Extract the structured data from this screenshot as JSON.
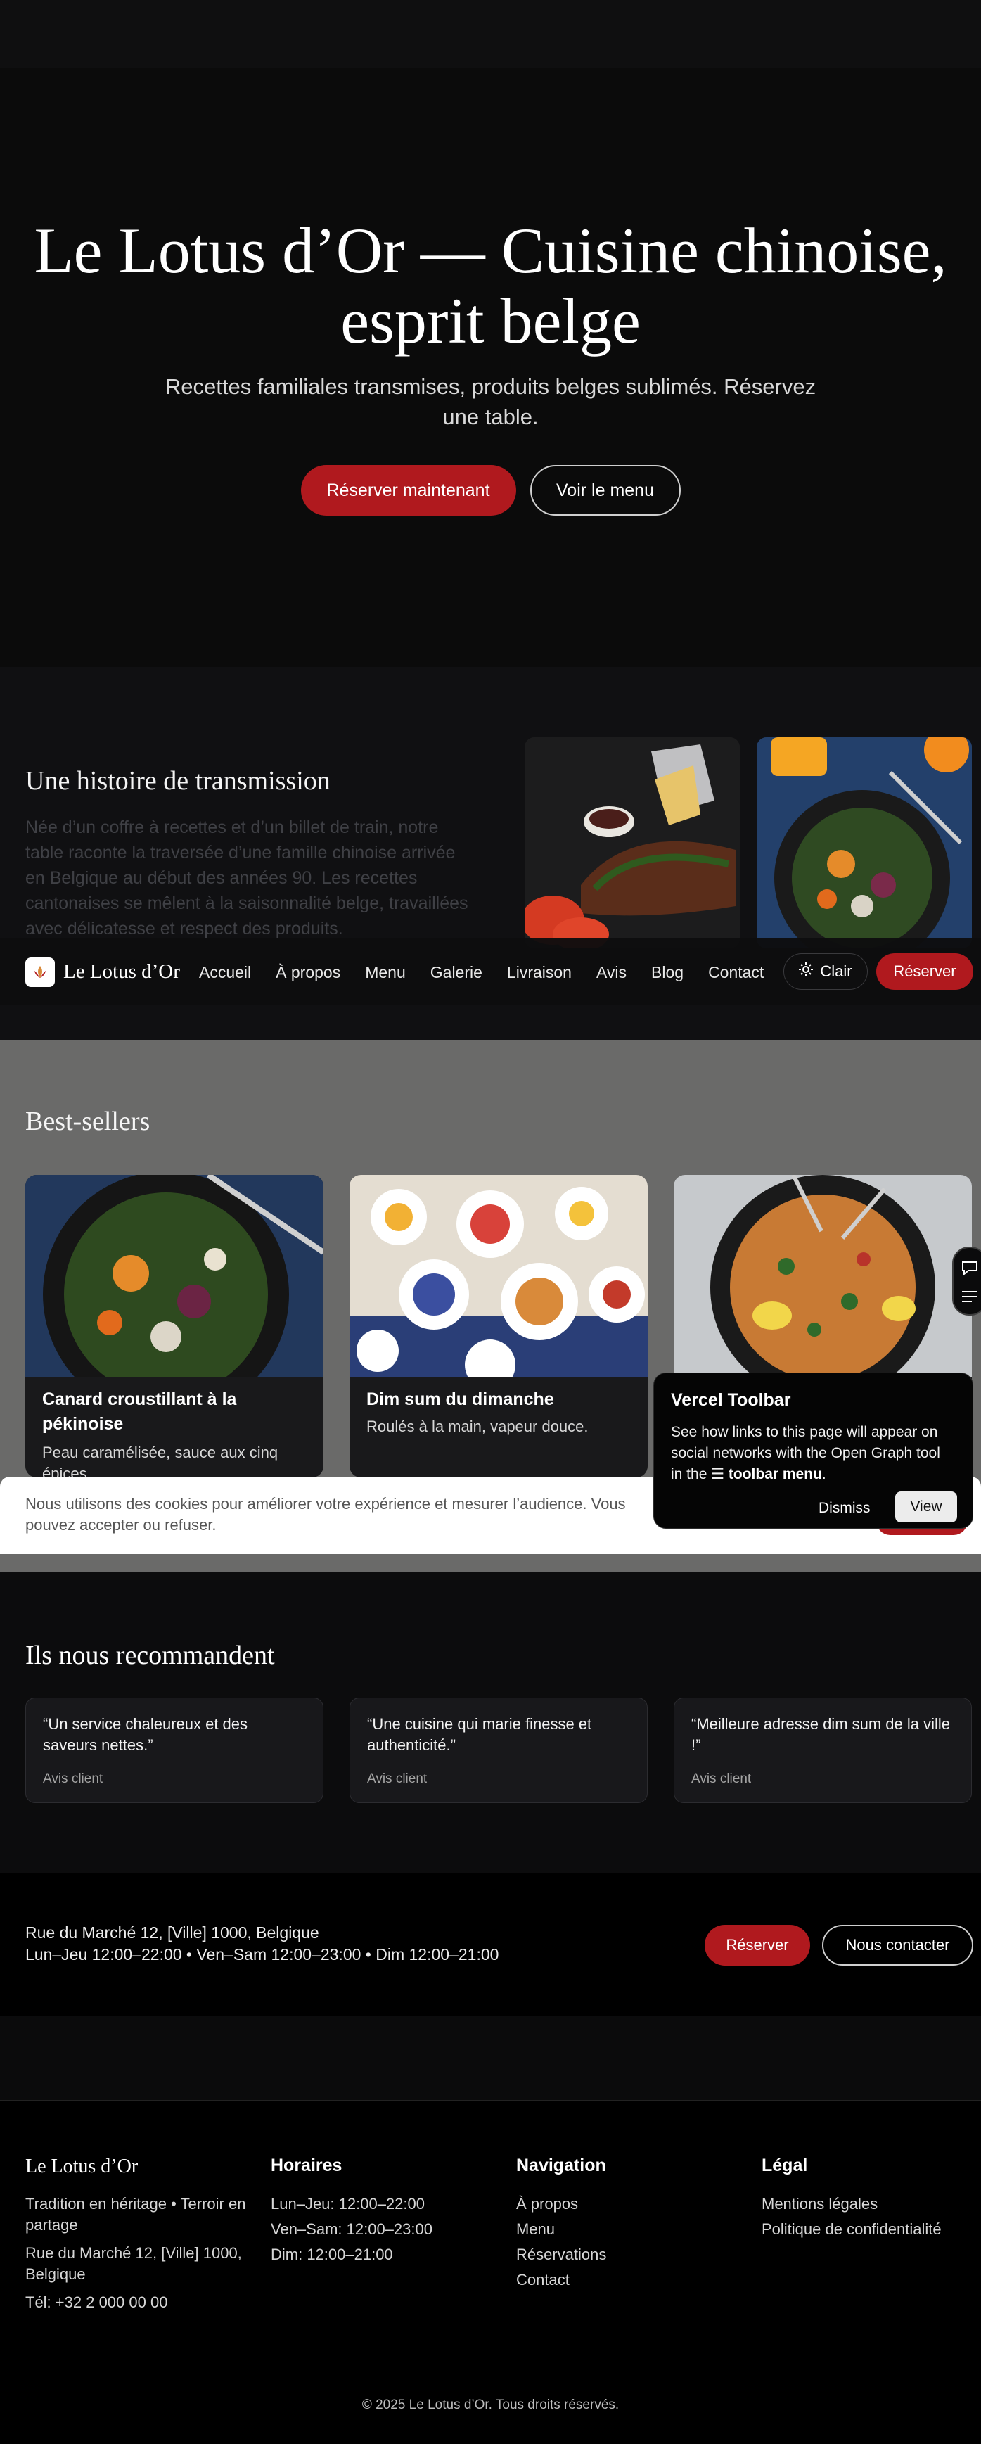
{
  "hero": {
    "title": "Le Lotus d’Or — Cuisine chinoise, esprit belge",
    "subtitle": "Recettes familiales transmises, produits belges sublimés. Réservez une table.",
    "primary_button": "Réserver maintenant",
    "secondary_button": "Voir le menu"
  },
  "story": {
    "title": "Une histoire de transmission",
    "text": "Née d’un coffre à recettes et d’un billet de train, notre table raconte la traversée d’une famille chinoise arrivée en Belgique au début des années 90. Les recettes cantonaises se mêlent à la saisonnalité belge, travaillées avec délicatesse et respect des produits."
  },
  "nav": {
    "brand": "Le Lotus d’Or",
    "links": [
      "Accueil",
      "À propos",
      "Menu",
      "Galerie",
      "Livraison",
      "Avis",
      "Blog",
      "Contact"
    ],
    "theme_label": "Clair",
    "reserve": "Réserver"
  },
  "bestsellers": {
    "title": "Best-sellers",
    "items": [
      {
        "name": "Canard croustillant à la pékinoise",
        "desc": "Peau caramélisée, sauce aux cinq épices."
      },
      {
        "name": "Dim sum du dimanche",
        "desc": "Roulés à la main, vapeur douce."
      },
      {
        "name": "",
        "desc": ""
      }
    ]
  },
  "vercel": {
    "title": "Vercel Toolbar",
    "body_pre": "See how links to this page will appear on social networks with the Open Graph tool in the ",
    "body_bold": "toolbar menu",
    "body_post": ".",
    "dismiss": "Dismiss",
    "view": "View"
  },
  "cookie": {
    "text": "Nous utilisons des cookies pour améliorer votre expérience et mesurer l’audience. Vous pouvez accepter ou refuser."
  },
  "reviews": {
    "title": "Ils nous recommandent",
    "items": [
      {
        "quote": "“Un service chaleureux et des saveurs nettes.”",
        "author": "Avis client"
      },
      {
        "quote": "“Une cuisine qui marie finesse et authenticité.”",
        "author": "Avis client"
      },
      {
        "quote": "“Meilleure adresse dim sum de la ville !”",
        "author": "Avis client"
      }
    ]
  },
  "address": {
    "line1": "Rue du Marché 12, [Ville] 1000, Belgique",
    "line2": "Lun–Jeu 12:00–22:00 • Ven–Sam 12:00–23:00 • Dim 12:00–21:00",
    "reserve": "Réserver",
    "contact": "Nous contacter"
  },
  "footer": {
    "brand": "Le Lotus d’Or",
    "tagline": "Tradition en héritage • Terroir en partage",
    "address": "Rue du Marché 12, [Ville] 1000, Belgique",
    "phone": "Tél: +32 2 000 00 00",
    "hours_title": "Horaires",
    "hours": [
      "Lun–Jeu: 12:00–22:00",
      "Ven–Sam: 12:00–23:00",
      "Dim: 12:00–21:00"
    ],
    "nav_title": "Navigation",
    "nav": [
      "À propos",
      "Menu",
      "Réservations",
      "Contact"
    ],
    "legal_title": "Légal",
    "legal": [
      "Mentions légales",
      "Politique de confidentialité"
    ],
    "copyright": "© 2025 Le Lotus d’Or. Tous droits réservés."
  },
  "colors": {
    "accent_red": "#b0191e",
    "background": "#0b0b0c",
    "bestsellers_bg": "#6a6a69"
  }
}
